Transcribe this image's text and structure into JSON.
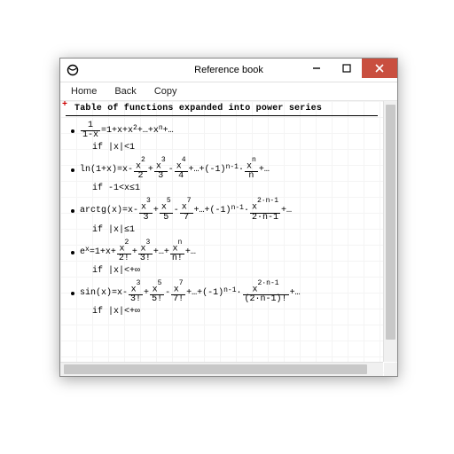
{
  "window_title": "Reference book",
  "menu": {
    "home": "Home",
    "back": "Back",
    "copy": "Copy"
  },
  "heading": "Table of functions expanded into power series",
  "series": [
    {
      "lhs": "1/(1-x)",
      "expansion_tokens": [
        "=1+x+x",
        "2",
        "+…+x",
        "n",
        "+…"
      ],
      "condition": "if   |x|<1"
    },
    {
      "lhs": "ln(1+x)",
      "terms_tex": "= x - x^2/2 + x^3/3 - x^4/4 + … + (-1)^{n-1}·x^n/n + …",
      "condition": "if   -1<x≤1"
    },
    {
      "lhs": "arctg(x)",
      "terms_tex": "= x - x^3/3 + x^5/5 - x^7/7 + … + (-1)^{n-1}·x^{2n-1}/(2n-1) + …",
      "condition": "if   |x|≤1"
    },
    {
      "lhs": "e^x",
      "terms_tex": "= 1 + x + x^2/2! + x^3/3! + … + x^n/n! + …",
      "condition": "if   |x|<+∞"
    },
    {
      "lhs": "sin(x)",
      "terms_tex": "= x - x^3/3! + x^5/5! - x^7/7! + … + (-1)^{n-1}·x^{2n-1}/(2n-1)! + …",
      "condition": "if   |x|<+∞"
    }
  ],
  "chart_data": {
    "type": "table",
    "title": "Table of functions expanded into power series",
    "rows": [
      {
        "function": "1/(1-x)",
        "series": "1 + x + x^2 + … + x^n + …",
        "domain": "|x|<1"
      },
      {
        "function": "ln(1+x)",
        "series": "x - x^2/2 + x^3/3 - x^4/4 + … + (-1)^{n-1} x^n/n + …",
        "domain": "-1<x≤1"
      },
      {
        "function": "arctg(x)",
        "series": "x - x^3/3 + x^5/5 - x^7/7 + … + (-1)^{n-1} x^{2n-1}/(2n-1) + …",
        "domain": "|x|≤1"
      },
      {
        "function": "e^x",
        "series": "1 + x + x^2/2! + x^3/3! + … + x^n/n! + …",
        "domain": "|x|<+∞"
      },
      {
        "function": "sin(x)",
        "series": "x - x^3/3! + x^5/5! - x^7/7! + … + (-1)^{n-1} x^{2n-1}/(2n-1)! + …",
        "domain": "|x|<+∞"
      }
    ]
  }
}
